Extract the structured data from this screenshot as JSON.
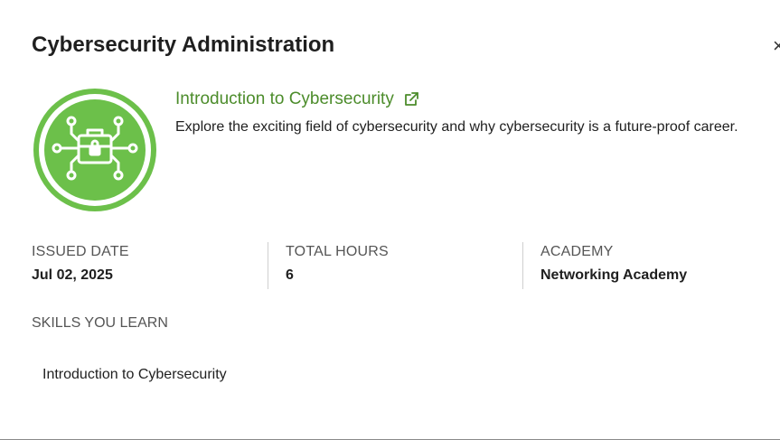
{
  "header": {
    "title": "Cybersecurity Administration",
    "close_glyph": "×"
  },
  "course": {
    "badge_icon": "cybersecurity-badge-icon",
    "link_text": "Introduction to Cybersecurity",
    "link_icon": "external-link-icon",
    "description": "Explore the exciting field of cybersecurity and why cybersecurity is a future-proof career."
  },
  "stats": {
    "issued": {
      "label": "ISSUED DATE",
      "value": "Jul 02, 2025"
    },
    "hours": {
      "label": "TOTAL HOURS",
      "value": "6"
    },
    "academy": {
      "label": "ACADEMY",
      "value": "Networking Academy"
    }
  },
  "skills": {
    "label": "SKILLS YOU LEARN",
    "items": [
      "Introduction to Cybersecurity"
    ]
  },
  "colors": {
    "accent_green": "#4c8c2b",
    "badge_green": "#6cc04a"
  }
}
